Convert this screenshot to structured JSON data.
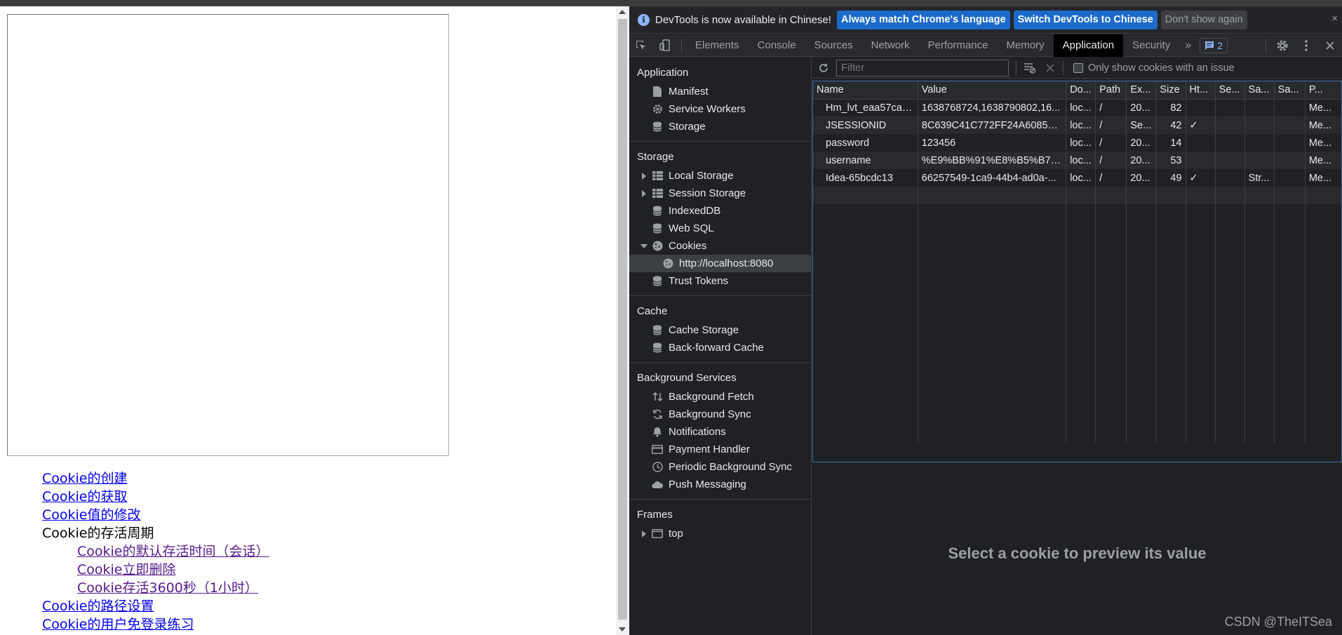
{
  "page": {
    "links": [
      {
        "label": "Cookie的创建",
        "kind": "link"
      },
      {
        "label": "Cookie的获取",
        "kind": "link"
      },
      {
        "label": "Cookie值的修改",
        "kind": "link"
      },
      {
        "label": "Cookie的存活周期",
        "kind": "plain"
      },
      {
        "label": "Cookie的默认存活时间（会话）",
        "kind": "sub"
      },
      {
        "label": "Cookie立即删除",
        "kind": "sub"
      },
      {
        "label": "Cookie存活3600秒（1小时）",
        "kind": "sub"
      },
      {
        "label": "Cookie的路径设置",
        "kind": "link"
      },
      {
        "label": "Cookie的用户免登录练习",
        "kind": "link"
      }
    ]
  },
  "infobar": {
    "message": "DevTools is now available in Chinese!",
    "btn_match": "Always match Chrome's language",
    "btn_switch": "Switch DevTools to Chinese",
    "btn_dismiss": "Don't show again",
    "close": "×"
  },
  "tabs": [
    "Elements",
    "Console",
    "Sources",
    "Network",
    "Performance",
    "Memory",
    "Application",
    "Security"
  ],
  "active_tab": "Application",
  "tabs_more": "»",
  "issues_count": "2",
  "sidebar": {
    "application": {
      "title": "Application",
      "items": [
        "Manifest",
        "Service Workers",
        "Storage"
      ]
    },
    "storage": {
      "title": "Storage",
      "items": [
        "Local Storage",
        "Session Storage",
        "IndexedDB",
        "Web SQL",
        "Cookies",
        "http://localhost:8080",
        "Trust Tokens"
      ]
    },
    "cache": {
      "title": "Cache",
      "items": [
        "Cache Storage",
        "Back-forward Cache"
      ]
    },
    "background": {
      "title": "Background Services",
      "items": [
        "Background Fetch",
        "Background Sync",
        "Notifications",
        "Payment Handler",
        "Periodic Background Sync",
        "Push Messaging"
      ]
    },
    "frames": {
      "title": "Frames",
      "items": [
        "top"
      ]
    }
  },
  "toolbar": {
    "filter_placeholder": "Filter",
    "only_issue_label": "Only show cookies with an issue"
  },
  "cookies": {
    "columns": [
      "Name",
      "Value",
      "Do...",
      "Path",
      "Ex...",
      "Size",
      "Ht...",
      "Se...",
      "Sa...",
      "Sa...",
      "P..."
    ],
    "rows": [
      [
        "Hm_lvt_eaa57ca4...",
        "1638768724,1638790802,16...",
        "loc...",
        "/",
        "20...",
        "82",
        "",
        "",
        "",
        "",
        "Me..."
      ],
      [
        "JSESSIONID",
        "8C639C41C772FF24A6085B...",
        "loc...",
        "/",
        "Se...",
        "42",
        "✓",
        "",
        "",
        "",
        "Me..."
      ],
      [
        "password",
        "123456",
        "loc...",
        "/",
        "20...",
        "14",
        "",
        "",
        "",
        "",
        "Me..."
      ],
      [
        "username",
        "%E9%BB%91%E8%B5%B7%...",
        "loc...",
        "/",
        "20...",
        "53",
        "",
        "",
        "",
        "",
        "Me..."
      ],
      [
        "Idea-65bcdc13",
        "66257549-1ca9-44b4-ad0a-...",
        "loc...",
        "/",
        "20...",
        "49",
        "✓",
        "",
        "Str...",
        "",
        "Me..."
      ]
    ]
  },
  "preview_text": "Select a cookie to preview its value",
  "watermark": "CSDN @TheITSea",
  "colors": {
    "accent": "#1b6ac9",
    "panel_bg": "#202124",
    "link": "#0000ee"
  }
}
